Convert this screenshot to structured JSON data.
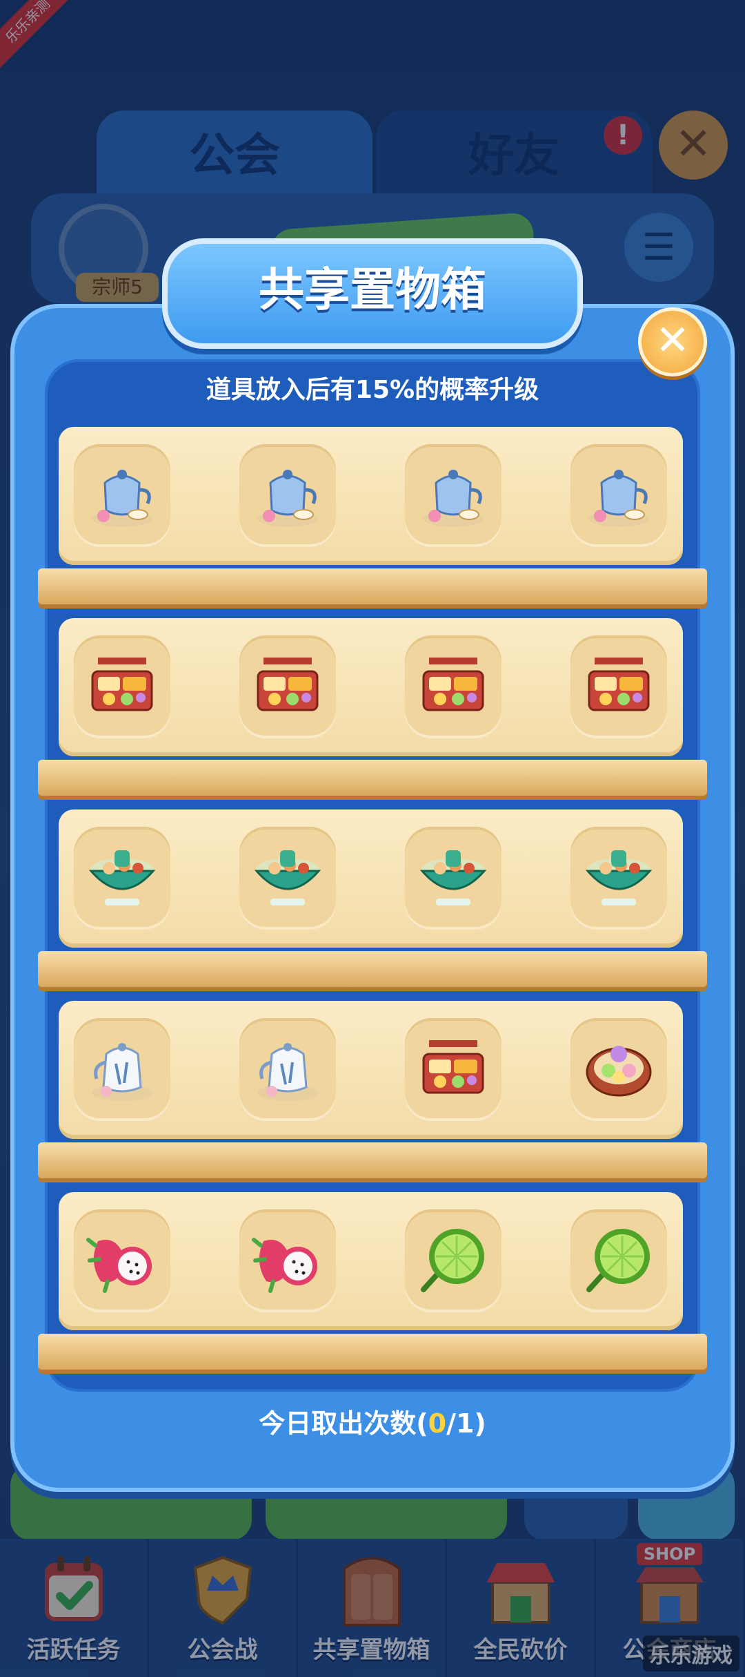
{
  "corner_ribbon": "乐乐亲测",
  "tabs": {
    "guild": "公会",
    "friends": "好友",
    "alert": "!"
  },
  "guild_bar": {
    "badge_label": "宗师5"
  },
  "modal": {
    "title": "共享置物箱",
    "subtitle": "道具放入后有15%的概率升级",
    "shelves": [
      [
        "teapot-set-icon",
        "teapot-set-icon",
        "teapot-set-icon",
        "teapot-set-icon"
      ],
      [
        "bento-box-icon",
        "bento-box-icon",
        "bento-box-icon",
        "bento-box-icon"
      ],
      [
        "hotpot-icon",
        "hotpot-icon",
        "hotpot-icon",
        "hotpot-icon"
      ],
      [
        "porcelain-teapot-icon",
        "porcelain-teapot-icon",
        "bento-box-icon",
        "sweets-plate-icon"
      ],
      [
        "dragon-fruit-icon",
        "dragon-fruit-icon",
        "lime-icon",
        "lime-icon"
      ]
    ],
    "footer": {
      "prefix": "今日取出次数(",
      "count": "0",
      "suffix": "/1)"
    }
  },
  "bottom_nav": [
    {
      "label": "活跃任务",
      "icon": "calendar-check-icon"
    },
    {
      "label": "公会战",
      "icon": "crown-shield-icon"
    },
    {
      "label": "共享置物箱",
      "icon": "cabinet-icon"
    },
    {
      "label": "全民砍价",
      "icon": "storefront-icon"
    },
    {
      "label": "公会商店",
      "icon": "shop-icon",
      "tag": "SHOP"
    }
  ],
  "watermark": "乐乐游戏",
  "colors": {
    "accent": "#3d8fe6",
    "shelf": "#fbecc7",
    "highlight": "#ffd23c",
    "close": "#f3a63b"
  }
}
